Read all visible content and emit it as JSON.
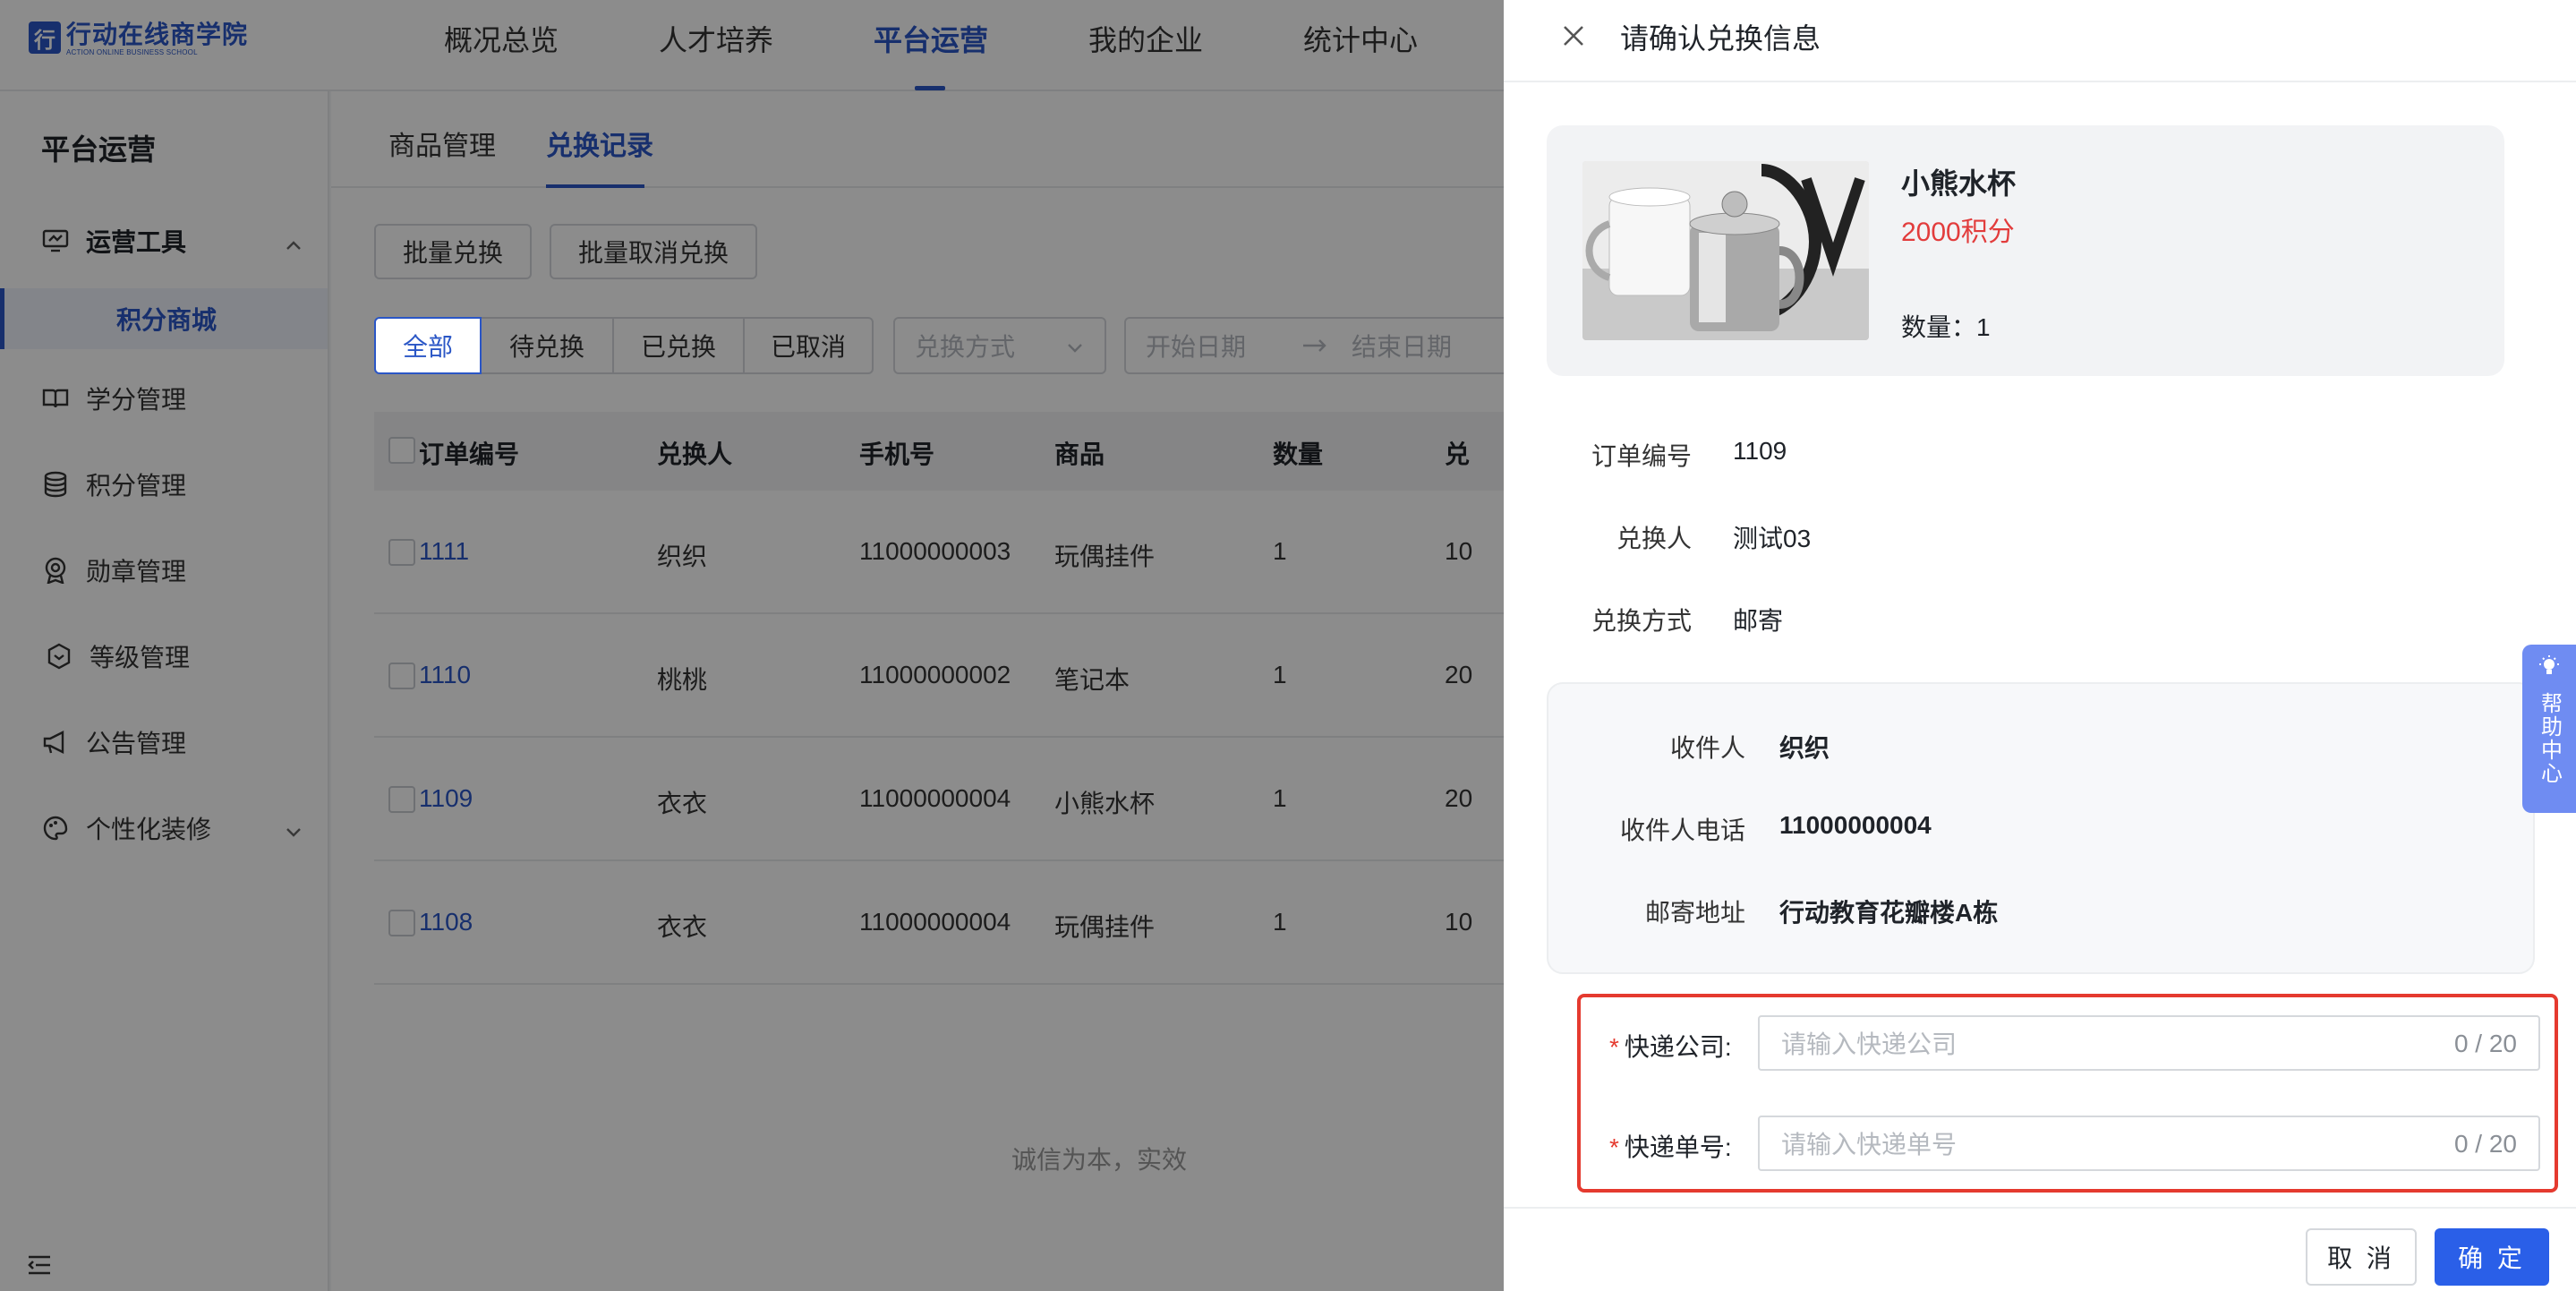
{
  "logo": {
    "mark": "行",
    "cn": "行动在线商学院",
    "en": "ACTION ONLINE BUSINESS SCHOOL"
  },
  "topnav": {
    "items": [
      {
        "label": "概况总览"
      },
      {
        "label": "人才培养"
      },
      {
        "label": "平台运营",
        "active": true
      },
      {
        "label": "我的企业"
      },
      {
        "label": "统计中心"
      }
    ]
  },
  "sidebar": {
    "title": "平台运营",
    "items": [
      {
        "label": "运营工具",
        "icon": "monitor-icon",
        "expanded": true
      },
      {
        "label": "积分商城",
        "sub": true,
        "active": true
      },
      {
        "label": "学分管理",
        "icon": "book-icon"
      },
      {
        "label": "积分管理",
        "icon": "coins-icon"
      },
      {
        "label": "勋章管理",
        "icon": "medal-icon"
      },
      {
        "label": "等级管理",
        "icon": "level-icon"
      },
      {
        "label": "公告管理",
        "icon": "megaphone-icon"
      },
      {
        "label": "个性化装修",
        "icon": "palette-icon",
        "expanded": false
      }
    ]
  },
  "main": {
    "tabs": [
      {
        "label": "商品管理"
      },
      {
        "label": "兑换记录",
        "active": true
      }
    ],
    "batch_redeem": "批量兑换",
    "batch_cancel": "批量取消兑换",
    "status_filters": [
      {
        "label": "全部",
        "active": true
      },
      {
        "label": "待兑换"
      },
      {
        "label": "已兑换"
      },
      {
        "label": "已取消"
      }
    ],
    "method_placeholder": "兑换方式",
    "start_date_placeholder": "开始日期",
    "end_date_placeholder": "结束日期",
    "columns": [
      "订单编号",
      "兑换人",
      "手机号",
      "商品",
      "数量",
      "兑"
    ],
    "rows": [
      {
        "order": "1111",
        "user": "织织",
        "phone": "11000000003",
        "product": "玩偶挂件",
        "qty": "1",
        "extra": "10"
      },
      {
        "order": "1110",
        "user": "桃桃",
        "phone": "11000000002",
        "product": "笔记本",
        "qty": "1",
        "extra": "20"
      },
      {
        "order": "1109",
        "user": "衣衣",
        "phone": "11000000004",
        "product": "小熊水杯",
        "qty": "1",
        "extra": "20"
      },
      {
        "order": "1108",
        "user": "衣衣",
        "phone": "11000000004",
        "product": "玩偶挂件",
        "qty": "1",
        "extra": "10"
      }
    ],
    "footer": "诚信为本，实效"
  },
  "drawer": {
    "title": "请确认兑换信息",
    "product": {
      "name": "小熊水杯",
      "points": "2000积分",
      "qty_label": "数量：",
      "qty": "1"
    },
    "info": [
      {
        "label": "订单编号",
        "value": "1109"
      },
      {
        "label": "兑换人",
        "value": "测试03"
      },
      {
        "label": "兑换方式",
        "value": "邮寄"
      }
    ],
    "recipient": [
      {
        "label": "收件人",
        "value": "织织"
      },
      {
        "label": "收件人电话",
        "value": "11000000004"
      },
      {
        "label": "邮寄地址",
        "value": "行动教育花瓣楼A栋"
      }
    ],
    "form": {
      "company": {
        "label": "快递公司:",
        "placeholder": "请输入快递公司",
        "count": "0 / 20"
      },
      "tracking": {
        "label": "快递单号:",
        "placeholder": "请输入快递单号",
        "count": "0 / 20"
      }
    },
    "cancel": "取 消",
    "confirm": "确 定"
  },
  "help": {
    "label": "帮助中心"
  },
  "colors": {
    "primary": "#2a56c6",
    "confirm": "#2a5fe8",
    "danger": "#e53a2f",
    "points": "#e23c3c"
  }
}
